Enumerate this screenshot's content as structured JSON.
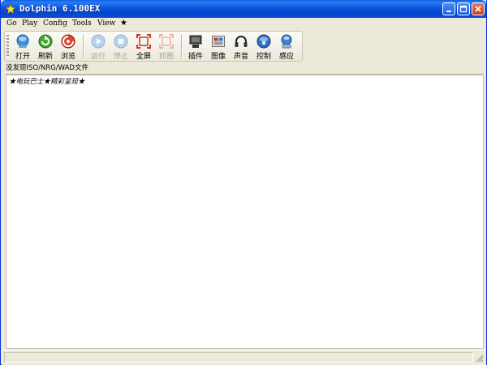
{
  "window": {
    "title": "Dolphin 6.100EX",
    "controls": {
      "minimize": "minimize-icon",
      "maximize": "maximize-icon",
      "close": "close-icon"
    }
  },
  "menu": {
    "items": [
      "Go",
      "Play",
      "Config",
      "Tools",
      "View",
      "★"
    ]
  },
  "toolbar": {
    "open": {
      "label": "打开",
      "icon": "open-icon"
    },
    "refresh": {
      "label": "刷新",
      "icon": "refresh-icon"
    },
    "browse": {
      "label": "浏览",
      "icon": "browse-icon"
    },
    "run": {
      "label": "运行",
      "icon": "play-icon",
      "disabled": true
    },
    "stop": {
      "label": "停止",
      "icon": "stop-icon",
      "disabled": true
    },
    "fullscreen": {
      "label": "全屏",
      "icon": "fullscreen-icon"
    },
    "screenshot": {
      "label": "抓图",
      "icon": "screenshot-icon",
      "disabled": true
    },
    "plugins": {
      "label": "插件",
      "icon": "plugin-icon"
    },
    "graphics": {
      "label": "图像",
      "icon": "graphics-icon"
    },
    "sound": {
      "label": "声音",
      "icon": "headphones-icon"
    },
    "controls": {
      "label": "控制",
      "icon": "controller-icon"
    },
    "sensor": {
      "label": "感应",
      "icon": "wiimote-icon"
    }
  },
  "status": {
    "message": "没发现ISO/NRG/WAD文件"
  },
  "content": {
    "text": "★电玩巴士★精彩呈现★"
  },
  "colors": {
    "titlebar": "#0a55d8",
    "window_bg": "#ece9d8",
    "list_bg": "#ffffff"
  }
}
